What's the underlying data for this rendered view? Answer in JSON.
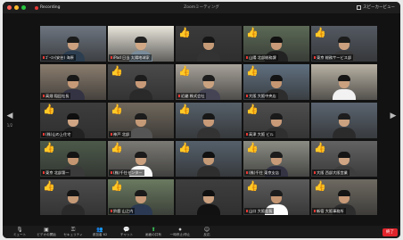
{
  "window": {
    "title": "Zoomミーティング",
    "recording_label": "Recording",
    "speaker_view_label": "スピーカービュー",
    "page_indicator": "1/2",
    "colors": {
      "recording": "#e53935",
      "share": "#3ccf5c",
      "end": "#e0242b",
      "thumb": "#f2b72c"
    }
  },
  "tiles": [
    {
      "name": "ｺﾞｰｽﾄ(安芸) 海原",
      "thumb": false,
      "bg": "#6d7580",
      "body": "#2c3e50",
      "face": "#caa07f",
      "hair": "#1b1b1b"
    },
    {
      "name": "iPad 日当 太陽地球家",
      "thumb": false,
      "bg": "#e9e6db",
      "body": "#7a8c9a",
      "face": "#d1a886",
      "hair": "#222"
    },
    {
      "name": "",
      "thumb": true,
      "bg": "#3a3a3a",
      "body": "#333",
      "face": "#c59a77",
      "hair": "#151515"
    },
    {
      "name": "山陽 北部総務課",
      "thumb": true,
      "bg": "#5c6a56",
      "body": "#222",
      "face": "#c89a78",
      "hair": "#111"
    },
    {
      "name": "東京 総務サービス部",
      "thumb": true,
      "bg": "#545a63",
      "body": "#3b3b3b",
      "face": "#caa07f",
      "hair": "#1c1c1c"
    },
    {
      "name": "高畑 稲田社長",
      "thumb": false,
      "bg": "#8a7d6e",
      "body": "#334",
      "face": "#c79a77",
      "hair": "#181818"
    },
    {
      "name": "",
      "thumb": true,
      "bg": "#4b4b4b",
      "body": "#2a2a2a",
      "face": "#c89a78",
      "hair": "#1c1c1c"
    },
    {
      "name": "近畿 株式会社",
      "thumb": true,
      "bg": "#a7a29a",
      "body": "#445",
      "face": "#cba27f",
      "hair": "#1e1e1e"
    },
    {
      "name": "大阪 大阪中央店",
      "thumb": true,
      "bg": "#607080",
      "body": "#2d2d2d",
      "face": "#c49672",
      "hair": "#141414"
    },
    {
      "name": "",
      "thumb": false,
      "bg": "#b9b2a4",
      "body": "#f2f2f2",
      "face": "#caa07f",
      "hair": "#151515"
    },
    {
      "name": "(株)山の上住宅",
      "thumb": true,
      "bg": "#3d3d3d",
      "body": "#222",
      "face": "#cfa584",
      "hair": "#0f0f0f"
    },
    {
      "name": "神戸 北部",
      "thumb": true,
      "bg": "#70685c",
      "body": "#555",
      "face": "#c59a77",
      "hair": "#1c1c1c"
    },
    {
      "name": "",
      "thumb": true,
      "bg": "#56606a",
      "body": "#333",
      "face": "#c89a78",
      "hair": "#181818"
    },
    {
      "name": "高津 大阪 ビル",
      "thumb": true,
      "bg": "#4e4e4e",
      "body": "#2f2f2f",
      "face": "#c89a78",
      "hair": "#1a1a1a"
    },
    {
      "name": "",
      "thumb": false,
      "bg": "#5a6470",
      "body": "#2b2b2b",
      "face": "#cba27f",
      "hair": "#1d1d1d"
    },
    {
      "name": "東京 北部第一",
      "thumb": true,
      "bg": "#4c5a4a",
      "body": "#3a3a3a",
      "face": "#c49672",
      "hair": "#141414"
    },
    {
      "name": "(株)千住センター",
      "thumb": true,
      "bg": "#7b7a74",
      "body": "#fafafa",
      "face": "#caa07f",
      "hair": "#1b1b1b"
    },
    {
      "name": "",
      "thumb": true,
      "bg": "#55606b",
      "body": "#2e2e2e",
      "face": "#c59a77",
      "hair": "#111"
    },
    {
      "name": "(株)千住 東京支店",
      "thumb": true,
      "bg": "#8b8d84",
      "body": "#334",
      "face": "#c89a78",
      "hair": "#1c1c1c"
    },
    {
      "name": "大阪 西部大阪営業",
      "thumb": true,
      "bg": "#636363",
      "body": "#3d3d3d",
      "face": "#cfa584",
      "hair": "#161616"
    },
    {
      "name": "",
      "thumb": true,
      "bg": "#4c4c4c",
      "body": "#2a2a2a",
      "face": "#c59a77",
      "hair": "#151515"
    },
    {
      "name": "鈴鹿 山之内",
      "thumb": true,
      "bg": "#6a7a60",
      "body": "#2b3a52",
      "face": "#c89a78",
      "hair": "#1a1a1a"
    },
    {
      "name": "",
      "thumb": false,
      "bg": "#3e3e3e",
      "body": "#111",
      "face": "#caa07f",
      "hair": "#0f0f0f"
    },
    {
      "name": "山口 大阪社長",
      "thumb": true,
      "bg": "#5b5b5b",
      "body": "#fefefe",
      "face": "#c49672",
      "hair": "#1c1c1c"
    },
    {
      "name": "新宿 大阪事務所",
      "thumb": true,
      "bg": "#6e6a62",
      "body": "#2d2d2d",
      "face": "#c89a78",
      "hair": "#141414"
    }
  ],
  "toolbar": {
    "items": [
      {
        "icon": "🎙",
        "label": "ミュート"
      },
      {
        "icon": "▣",
        "label": "ビデオの開始"
      },
      {
        "icon": "⚿",
        "label": "セキュリティ"
      },
      {
        "icon": "👥",
        "label": "参加者 62"
      },
      {
        "icon": "💬",
        "label": "チャット"
      },
      {
        "icon": "⬆",
        "label": "画面の共有"
      },
      {
        "icon": "⏺",
        "label": "一時停止/停止"
      },
      {
        "icon": "☺",
        "label": "反応"
      }
    ],
    "end_label": "終了"
  }
}
